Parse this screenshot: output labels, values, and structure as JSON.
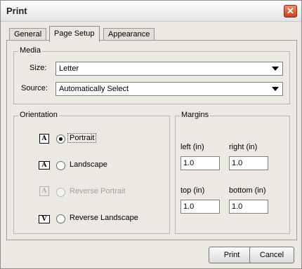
{
  "window": {
    "title": "Print",
    "close_glyph": "✕"
  },
  "tabs": [
    {
      "label": "General",
      "active": false
    },
    {
      "label": "Page Setup",
      "active": true
    },
    {
      "label": "Appearance",
      "active": false
    }
  ],
  "media": {
    "group_label": "Media",
    "size_label": "Size:",
    "size_value": "Letter",
    "source_label": "Source:",
    "source_value": "Automatically Select"
  },
  "orientation": {
    "group_label": "Orientation",
    "options": [
      {
        "label": "Portrait",
        "icon_glyph": "A",
        "checked": true,
        "enabled": true
      },
      {
        "label": "Landscape",
        "icon_glyph": "A",
        "checked": false,
        "enabled": true
      },
      {
        "label": "Reverse Portrait",
        "icon_glyph": "A",
        "checked": false,
        "enabled": false
      },
      {
        "label": "Reverse Landscape",
        "icon_glyph": "V",
        "checked": false,
        "enabled": true
      }
    ]
  },
  "margins": {
    "group_label": "Margins",
    "left_label": "left (in)",
    "left_value": "1.0",
    "right_label": "right (in)",
    "right_value": "1.0",
    "top_label": "top (in)",
    "top_value": "1.0",
    "bottom_label": "bottom (in)",
    "bottom_value": "1.0"
  },
  "buttons": {
    "print": "Print",
    "cancel": "Cancel"
  }
}
